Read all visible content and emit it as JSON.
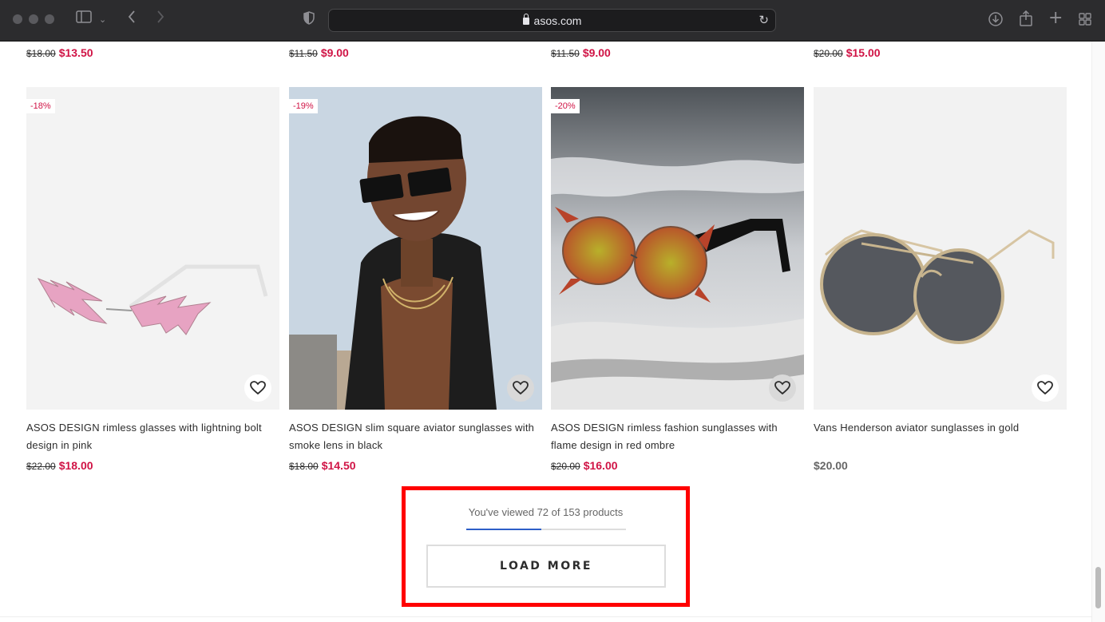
{
  "browser": {
    "url": "asos.com"
  },
  "previous_row": [
    {
      "old": "$18.00",
      "new": "$13.50"
    },
    {
      "old": "$11.50",
      "new": "$9.00"
    },
    {
      "old": "$11.50",
      "new": "$9.00"
    },
    {
      "old": "$20.00",
      "new": "$15.00"
    }
  ],
  "products": [
    {
      "badge": "-18%",
      "title": "ASOS DESIGN rimless glasses with lightning bolt design in pink",
      "old": "$22.00",
      "new": "$18.00"
    },
    {
      "badge": "-19%",
      "title": "ASOS DESIGN slim square aviator sunglasses with smoke lens in black",
      "old": "$18.00",
      "new": "$14.50"
    },
    {
      "badge": "-20%",
      "title": "ASOS DESIGN rimless fashion sunglasses with flame design in red ombre",
      "old": "$20.00",
      "new": "$16.00"
    },
    {
      "badge": "",
      "title": "Vans Henderson aviator sunglasses in gold",
      "old": "",
      "price": "$20.00"
    }
  ],
  "progress": {
    "text": "You've viewed 72 of 153 products",
    "viewed": 72,
    "total": 153
  },
  "load_more_label": "LOAD MORE",
  "colors": {
    "sale": "#d01345",
    "progress": "#2d5ec8",
    "highlight": "#ff0000"
  }
}
